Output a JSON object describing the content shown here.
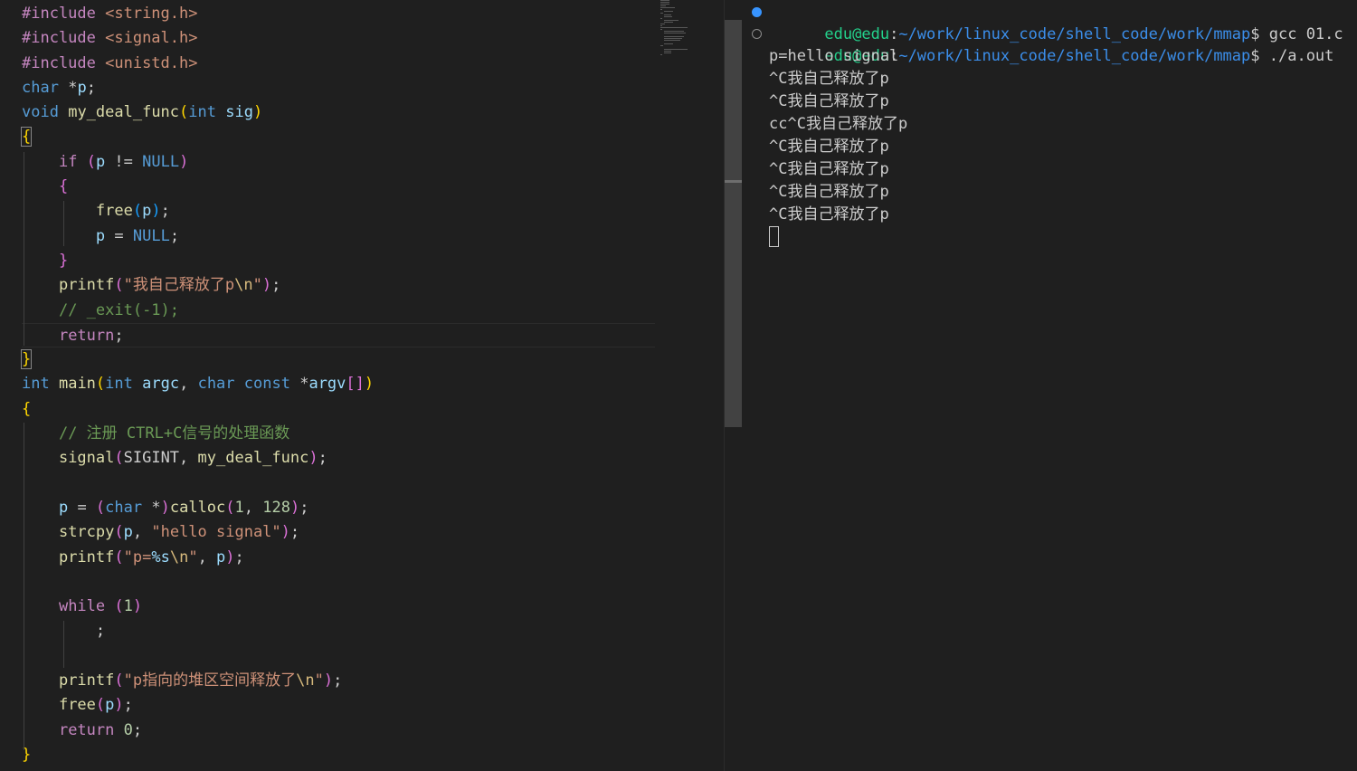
{
  "editor": {
    "lines": [
      [
        {
          "t": "#include ",
          "c": "inc"
        },
        {
          "t": "<string.h>",
          "c": "str"
        }
      ],
      [
        {
          "t": "#include ",
          "c": "inc"
        },
        {
          "t": "<signal.h>",
          "c": "str"
        }
      ],
      [
        {
          "t": "#include ",
          "c": "inc"
        },
        {
          "t": "<unistd.h>",
          "c": "str"
        }
      ],
      [
        {
          "t": "char",
          "c": "kw"
        },
        {
          "t": " *",
          "c": "p"
        },
        {
          "t": "p",
          "c": "var"
        },
        {
          "t": ";",
          "c": "p"
        }
      ],
      [
        {
          "t": "void",
          "c": "kw"
        },
        {
          "t": " ",
          "c": "p"
        },
        {
          "t": "my_deal_func",
          "c": "fn"
        },
        {
          "t": "(",
          "c": "b1"
        },
        {
          "t": "int",
          "c": "kw"
        },
        {
          "t": " ",
          "c": "p"
        },
        {
          "t": "sig",
          "c": "var"
        },
        {
          "t": ")",
          "c": "b1"
        }
      ],
      [
        {
          "t": "{",
          "c": "b1",
          "hl": true
        }
      ],
      [
        {
          "t": "    ",
          "c": "p"
        },
        {
          "t": "if",
          "c": "ctrl"
        },
        {
          "t": " ",
          "c": "p"
        },
        {
          "t": "(",
          "c": "b2"
        },
        {
          "t": "p",
          "c": "var"
        },
        {
          "t": " != ",
          "c": "p"
        },
        {
          "t": "NULL",
          "c": "macro"
        },
        {
          "t": ")",
          "c": "b2"
        }
      ],
      [
        {
          "t": "    ",
          "c": "p"
        },
        {
          "t": "{",
          "c": "b2"
        }
      ],
      [
        {
          "t": "        ",
          "c": "p"
        },
        {
          "t": "free",
          "c": "fn"
        },
        {
          "t": "(",
          "c": "b3"
        },
        {
          "t": "p",
          "c": "var"
        },
        {
          "t": ")",
          "c": "b3"
        },
        {
          "t": ";",
          "c": "p"
        }
      ],
      [
        {
          "t": "        ",
          "c": "p"
        },
        {
          "t": "p",
          "c": "var"
        },
        {
          "t": " = ",
          "c": "p"
        },
        {
          "t": "NULL",
          "c": "macro"
        },
        {
          "t": ";",
          "c": "p"
        }
      ],
      [
        {
          "t": "    ",
          "c": "p"
        },
        {
          "t": "}",
          "c": "b2"
        }
      ],
      [
        {
          "t": "    ",
          "c": "p"
        },
        {
          "t": "printf",
          "c": "fn"
        },
        {
          "t": "(",
          "c": "b2"
        },
        {
          "t": "\"我自己释放了p",
          "c": "str"
        },
        {
          "t": "\\n",
          "c": "esc"
        },
        {
          "t": "\"",
          "c": "str"
        },
        {
          "t": ")",
          "c": "b2"
        },
        {
          "t": ";",
          "c": "p"
        }
      ],
      [
        {
          "t": "    ",
          "c": "p"
        },
        {
          "t": "// _exit(-1);",
          "c": "cmt"
        }
      ],
      [
        {
          "t": "    ",
          "c": "p"
        },
        {
          "t": "return",
          "c": "ctrl"
        },
        {
          "t": ";",
          "c": "p"
        }
      ],
      [
        {
          "t": "}",
          "c": "b1",
          "hl": true
        }
      ],
      [
        {
          "t": "int",
          "c": "kw"
        },
        {
          "t": " ",
          "c": "p"
        },
        {
          "t": "main",
          "c": "fn"
        },
        {
          "t": "(",
          "c": "b1"
        },
        {
          "t": "int",
          "c": "kw"
        },
        {
          "t": " ",
          "c": "p"
        },
        {
          "t": "argc",
          "c": "var"
        },
        {
          "t": ", ",
          "c": "p"
        },
        {
          "t": "char",
          "c": "kw"
        },
        {
          "t": " ",
          "c": "p"
        },
        {
          "t": "const",
          "c": "kw"
        },
        {
          "t": " *",
          "c": "p"
        },
        {
          "t": "argv",
          "c": "var"
        },
        {
          "t": "[]",
          "c": "b2"
        },
        {
          "t": ")",
          "c": "b1"
        }
      ],
      [
        {
          "t": "{",
          "c": "b1"
        }
      ],
      [
        {
          "t": "    ",
          "c": "p"
        },
        {
          "t": "// 注册 CTRL+C信号的处理函数",
          "c": "cmt"
        }
      ],
      [
        {
          "t": "    ",
          "c": "p"
        },
        {
          "t": "signal",
          "c": "fn"
        },
        {
          "t": "(",
          "c": "b2"
        },
        {
          "t": "SIGINT",
          "c": "p"
        },
        {
          "t": ", ",
          "c": "p"
        },
        {
          "t": "my_deal_func",
          "c": "fn"
        },
        {
          "t": ")",
          "c": "b2"
        },
        {
          "t": ";",
          "c": "p"
        }
      ],
      [
        {
          "t": "",
          "c": "p"
        }
      ],
      [
        {
          "t": "    ",
          "c": "p"
        },
        {
          "t": "p",
          "c": "var"
        },
        {
          "t": " = ",
          "c": "p"
        },
        {
          "t": "(",
          "c": "b2"
        },
        {
          "t": "char",
          "c": "kw"
        },
        {
          "t": " *",
          "c": "p"
        },
        {
          "t": ")",
          "c": "b2"
        },
        {
          "t": "calloc",
          "c": "fn"
        },
        {
          "t": "(",
          "c": "b2"
        },
        {
          "t": "1",
          "c": "num"
        },
        {
          "t": ", ",
          "c": "p"
        },
        {
          "t": "128",
          "c": "num"
        },
        {
          "t": ")",
          "c": "b2"
        },
        {
          "t": ";",
          "c": "p"
        }
      ],
      [
        {
          "t": "    ",
          "c": "p"
        },
        {
          "t": "strcpy",
          "c": "fn"
        },
        {
          "t": "(",
          "c": "b2"
        },
        {
          "t": "p",
          "c": "var"
        },
        {
          "t": ", ",
          "c": "p"
        },
        {
          "t": "\"hello signal\"",
          "c": "str"
        },
        {
          "t": ")",
          "c": "b2"
        },
        {
          "t": ";",
          "c": "p"
        }
      ],
      [
        {
          "t": "    ",
          "c": "p"
        },
        {
          "t": "printf",
          "c": "fn"
        },
        {
          "t": "(",
          "c": "b2"
        },
        {
          "t": "\"p=",
          "c": "str"
        },
        {
          "t": "%s",
          "c": "var"
        },
        {
          "t": "\\n",
          "c": "esc"
        },
        {
          "t": "\"",
          "c": "str"
        },
        {
          "t": ", ",
          "c": "p"
        },
        {
          "t": "p",
          "c": "var"
        },
        {
          "t": ")",
          "c": "b2"
        },
        {
          "t": ";",
          "c": "p"
        }
      ],
      [
        {
          "t": "",
          "c": "p"
        }
      ],
      [
        {
          "t": "    ",
          "c": "p"
        },
        {
          "t": "while",
          "c": "ctrl"
        },
        {
          "t": " ",
          "c": "p"
        },
        {
          "t": "(",
          "c": "b2"
        },
        {
          "t": "1",
          "c": "num"
        },
        {
          "t": ")",
          "c": "b2"
        }
      ],
      [
        {
          "t": "        ",
          "c": "p"
        },
        {
          "t": ";",
          "c": "p"
        }
      ],
      [
        {
          "t": "",
          "c": "p"
        }
      ],
      [
        {
          "t": "    ",
          "c": "p"
        },
        {
          "t": "printf",
          "c": "fn"
        },
        {
          "t": "(",
          "c": "b2"
        },
        {
          "t": "\"p指向的堆区空间释放了",
          "c": "str"
        },
        {
          "t": "\\n",
          "c": "esc"
        },
        {
          "t": "\"",
          "c": "str"
        },
        {
          "t": ")",
          "c": "b2"
        },
        {
          "t": ";",
          "c": "p"
        }
      ],
      [
        {
          "t": "    ",
          "c": "p"
        },
        {
          "t": "free",
          "c": "fn"
        },
        {
          "t": "(",
          "c": "b2"
        },
        {
          "t": "p",
          "c": "var"
        },
        {
          "t": ")",
          "c": "b2"
        },
        {
          "t": ";",
          "c": "p"
        }
      ],
      [
        {
          "t": "    ",
          "c": "p"
        },
        {
          "t": "return",
          "c": "ctrl"
        },
        {
          "t": " ",
          "c": "p"
        },
        {
          "t": "0",
          "c": "num"
        },
        {
          "t": ";",
          "c": "p"
        }
      ],
      [
        {
          "t": "}",
          "c": "b1"
        }
      ]
    ]
  },
  "terminal": {
    "prompt_user": "edu@edu",
    "prompt_path": "~/work/linux_code/shell_code/work/mmap",
    "prompt_symbol": "$ ",
    "commands": [
      {
        "cmd": "gcc 01.c",
        "status": "success"
      },
      {
        "cmd": "./a.out",
        "status": "running"
      }
    ],
    "output": [
      "p=hello signal",
      "^C我自己释放了p",
      "^C我自己释放了p",
      "cc^C我自己释放了p",
      "^C我自己释放了p",
      "^C我自己释放了p",
      "^C我自己释放了p",
      "^C我自己释放了p"
    ]
  }
}
